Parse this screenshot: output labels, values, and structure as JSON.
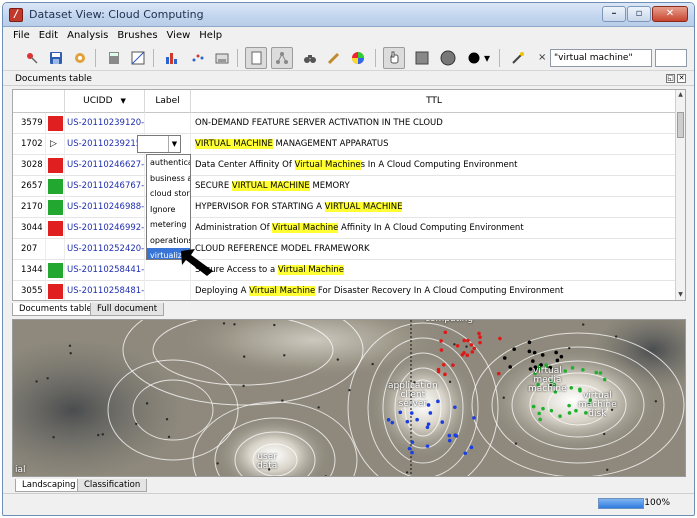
{
  "window": {
    "title": "Dataset View: Cloud Computing"
  },
  "menu": [
    "File",
    "Edit",
    "Analysis",
    "Brushes",
    "View",
    "Help"
  ],
  "toolbar": {
    "search_value": "\"virtual machine\"",
    "clear_symbol": "×"
  },
  "panel": {
    "title": "Documents table"
  },
  "table": {
    "headers": {
      "id": "UCIDD",
      "label": "Label",
      "ttl": "TTL"
    },
    "rows": [
      {
        "num": "3579",
        "color": "#e02020",
        "id": "US-20110239120-A1",
        "pre": "ON-DEMAND FEATURE SERVER ACTIVATION IN THE CLOUD",
        "hl": "",
        "post": ""
      },
      {
        "num": "1702",
        "color": "",
        "id": "US-20110239215-A1",
        "pre": "",
        "hl": "VIRTUAL MACHINE",
        "post": " MANAGEMENT APPARATUS"
      },
      {
        "num": "3028",
        "color": "#e02020",
        "id": "US-20110246627-A1",
        "pre": "Data Center Affinity Of ",
        "hl": "Virtual Machine",
        "post": "s In A Cloud Computing Environment"
      },
      {
        "num": "2657",
        "color": "#22a830",
        "id": "US-20110246767-A1",
        "pre": "SECURE ",
        "hl": "VIRTUAL MACHINE",
        "post": " MEMORY"
      },
      {
        "num": "2170",
        "color": "#22a830",
        "id": "US-20110246988-A1",
        "pre": "HYPERVISOR FOR STARTING A ",
        "hl": "VIRTUAL MACHINE",
        "post": ""
      },
      {
        "num": "3044",
        "color": "#e02020",
        "id": "US-20110246992-A1",
        "pre": "Administration Of ",
        "hl": "Virtual Machine",
        "post": " Affinity In A Cloud Computing Environment"
      },
      {
        "num": "207",
        "color": "",
        "id": "US-20110252420-A1",
        "pre": "CLOUD REFERENCE MODEL FRAMEWORK",
        "hl": "",
        "post": ""
      },
      {
        "num": "1344",
        "color": "#22a830",
        "id": "US-20110258441-A1",
        "pre": "Secure Access to a ",
        "hl": "Virtual Machine",
        "post": ""
      },
      {
        "num": "3055",
        "color": "#e02020",
        "id": "US-20110258481-A1",
        "pre": "Deploying A ",
        "hl": "Virtual Machine",
        "post": " For Disaster Recovery In A Cloud Computing Environment"
      }
    ]
  },
  "label_dropdown": {
    "options": [
      "authentication",
      "business a",
      "cloud stor",
      "Ignore",
      "metering",
      "operations",
      "virtualizati"
    ],
    "selected_index": 6
  },
  "top_tabs": [
    "Documents table",
    "Full document"
  ],
  "map_labels": {
    "application_client_server": [
      "application",
      "client",
      "server"
    ],
    "virtual_media_machine": [
      "virtual",
      "media",
      "machine"
    ],
    "virtual_machine_disk": [
      "virtual",
      "machine",
      "disk"
    ],
    "user_data": [
      "user",
      "data"
    ],
    "computing": "computing",
    "edge": "ial"
  },
  "bottom_tabs": [
    "Landscaping",
    "Classification"
  ],
  "status": {
    "progress_text": "100%",
    "progress": 1.0
  }
}
